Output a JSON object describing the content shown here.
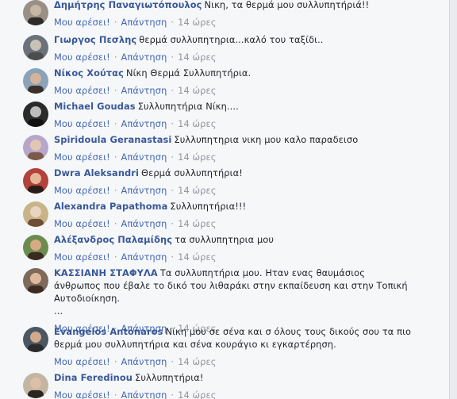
{
  "actions": {
    "like_label": "Μου αρέσει!",
    "reply_label": "Απάντηση",
    "separator": "·"
  },
  "comments": [
    {
      "author": "Δημήτρης Παναγιωτόπουλος",
      "text": "Νικη, τα θερμά μου συλλυπητήριά!!",
      "time": "14 ώρες",
      "avatar_colors": [
        "#9a8f84",
        "#c7b6a5",
        "#2e2a28"
      ]
    },
    {
      "author": "Γιωργος Πεσλης",
      "text": "θερμά συλλυπητηρια...καλό του ταξίδι..",
      "time": "14 ώρες",
      "avatar_colors": [
        "#6b7279",
        "#c9c2b8",
        "#4d4d4d"
      ]
    },
    {
      "author": "Νίκος Χούτας",
      "text": "Νίκη Θερμά Συλλυπητήρια.",
      "time": "14 ώρες",
      "avatar_colors": [
        "#8aa3b8",
        "#d6b49b",
        "#3b2f2a"
      ]
    },
    {
      "author": "Michael Goudas",
      "text": "Συλλυπητήρια Νίκη....",
      "time": "14 ώρες",
      "avatar_colors": [
        "#2b2b2b",
        "#bdbdbd",
        "#111111"
      ]
    },
    {
      "author": "Spiridoula Geranastasi",
      "text": "Συλλυπητηρια νικη μου καλο παραδεισο",
      "time": "14 ώρες",
      "avatar_colors": [
        "#b7a6c9",
        "#e2c8b4",
        "#7b5a4a"
      ]
    },
    {
      "author": "Dwra Aleksandri",
      "text": "Θερμά συλλυπητήρια!",
      "time": "14 ώρες",
      "avatar_colors": [
        "#b3413c",
        "#e6b796",
        "#2a1c18"
      ]
    },
    {
      "author": "Alexandra Papathoma",
      "text": "Συλλυπητήρια!!!",
      "time": "14 ώρες",
      "avatar_colors": [
        "#c9b48a",
        "#e9d4bf",
        "#6e4f33"
      ]
    },
    {
      "author": "Αλέξανδρος Παλαμίδης",
      "text": "τα συλλυπητηρια μου",
      "time": "14 ώρες",
      "avatar_colors": [
        "#6b8c4e",
        "#d8a985",
        "#3a2a20"
      ]
    },
    {
      "author": "ΚΑΣΣΙΑΝΗ ΣΤΑΦΥΛΑ",
      "text": "Τα συλλυπητήρια μου. Ηταν ενας θαυμάσιος άνθρωπος που έβαλε το δικό του λιθαράκι στην εκπαίδευση και στην Τοπική Αυτοδιοίκηση.",
      "ellipsis": "...",
      "time": "14 ώρες",
      "avatar_colors": [
        "#7d6a5a",
        "#e0b99c",
        "#3d2b22"
      ]
    },
    {
      "author": "Evangelos Antonaros",
      "text": "Νίκη μου σε σένα και σ όλους τους δικούς σου τα πιο θερμά μου συλλυπητήρια και σένα κουράγιο κι εγκαρτέρηση.",
      "time": "14 ώρες",
      "avatar_colors": [
        "#4a5663",
        "#d1a98b",
        "#2b2b2b"
      ]
    },
    {
      "author": "Dina Feredinou",
      "text": "Συλλυπητήρια!",
      "time": "14 ώρες",
      "avatar_colors": [
        "#c2b6a3",
        "#dcbfa8",
        "#2d2420"
      ]
    }
  ]
}
